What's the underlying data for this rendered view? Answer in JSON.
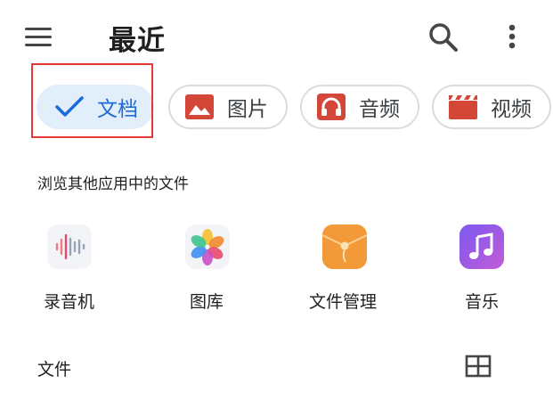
{
  "appbar": {
    "title": "最近"
  },
  "chips": [
    {
      "label": "文档",
      "icon": "check-icon",
      "selected": true
    },
    {
      "label": "图片",
      "icon": "image-icon",
      "selected": false
    },
    {
      "label": "音频",
      "icon": "headphones-icon",
      "selected": false
    },
    {
      "label": "视频",
      "icon": "movie-clapper-icon",
      "selected": false
    }
  ],
  "section": {
    "title": "浏览其他应用中的文件"
  },
  "apps": [
    {
      "label": "录音机",
      "icon": "voice-recorder-icon"
    },
    {
      "label": "图库",
      "icon": "gallery-icon"
    },
    {
      "label": "文件管理",
      "icon": "file-manager-icon"
    },
    {
      "label": "音乐",
      "icon": "music-icon"
    }
  ],
  "files": {
    "title": "文件"
  },
  "colors": {
    "accent": "#1a6cd8",
    "selected_chip_bg": "#e3eefb",
    "chip_icon_red": "#d44638",
    "highlight": "#e53935"
  }
}
